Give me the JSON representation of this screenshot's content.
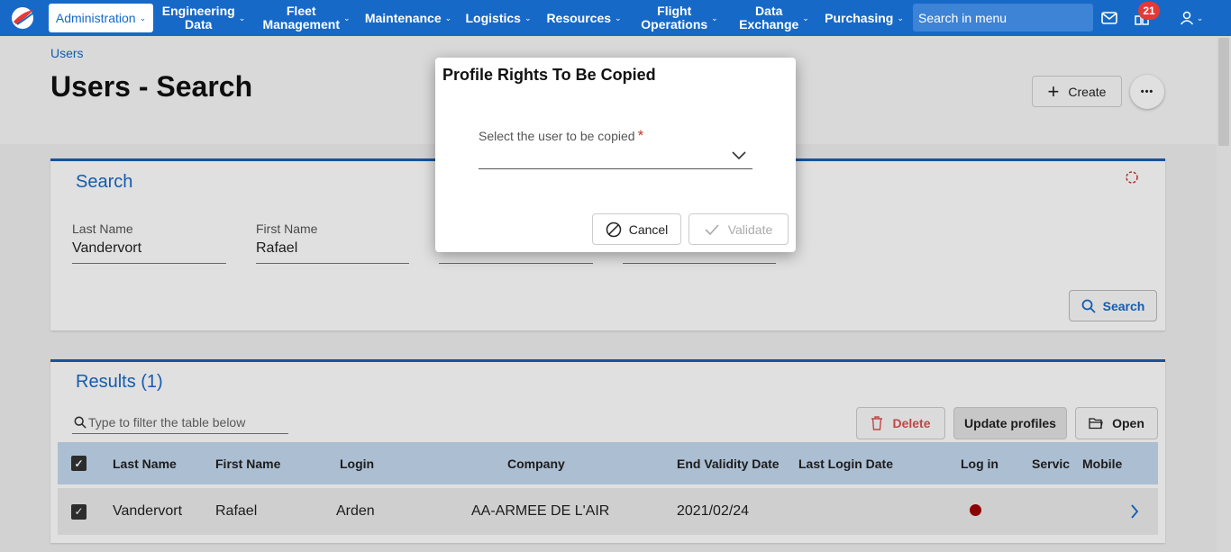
{
  "nav": {
    "active": "Administration",
    "items": [
      "Engineering Data",
      "Fleet Management",
      "Maintenance",
      "Logistics",
      "Resources",
      "Flight Operations",
      "Data Exchange",
      "Purchasing"
    ],
    "item_lines": [
      [
        "Engineering",
        "Data"
      ],
      [
        "Fleet",
        "Management"
      ],
      [
        "Maintenance"
      ],
      [
        "Logistics"
      ],
      [
        "Resources"
      ],
      [
        "Flight",
        "Operations"
      ],
      [
        "Data",
        "Exchange"
      ],
      [
        "Purchasing"
      ]
    ],
    "search_placeholder": "Search in menu",
    "notification_count": "21",
    "icons": [
      "logo-icon",
      "mail-icon",
      "notifications-icon",
      "user-icon"
    ]
  },
  "page": {
    "breadcrumb": "Users",
    "title": "Users - Search",
    "create_label": "Create",
    "more_label": "•••"
  },
  "search_panel": {
    "title": "Search",
    "fields": [
      {
        "label": "Last Name",
        "value": "Vandervort"
      },
      {
        "label": "First Name",
        "value": "Rafael"
      }
    ],
    "search_label": "Search"
  },
  "results": {
    "title": "Results (1)",
    "filter_placeholder": "Type to filter the table below",
    "delete_label": "Delete",
    "update_label": "Update profiles",
    "open_label": "Open",
    "columns": [
      "Last Name",
      "First Name",
      "Login",
      "Company",
      "End Validity Date",
      "Last Login Date",
      "Log in",
      "Servic",
      "Mobile"
    ],
    "rows": [
      {
        "last_name": "Vandervort",
        "first_name": "Rafael",
        "login": "Arden",
        "company": "AA-ARMEE DE L'AIR",
        "end_validity": "2021/02/24",
        "last_login": "",
        "log_in_status": "red-dot",
        "checked": true
      }
    ]
  },
  "modal": {
    "title": "Profile Rights To Be Copied",
    "label": "Select the user to be copied",
    "required_marker": "*",
    "cancel_label": "Cancel",
    "validate_label": "Validate"
  },
  "colors": {
    "nav_bg": "#1769c7",
    "accent": "#1760b0",
    "table_header": "#c4d9ef",
    "delete_red": "#d9534f",
    "status_dot": "#a00000",
    "badge": "#e53935"
  }
}
